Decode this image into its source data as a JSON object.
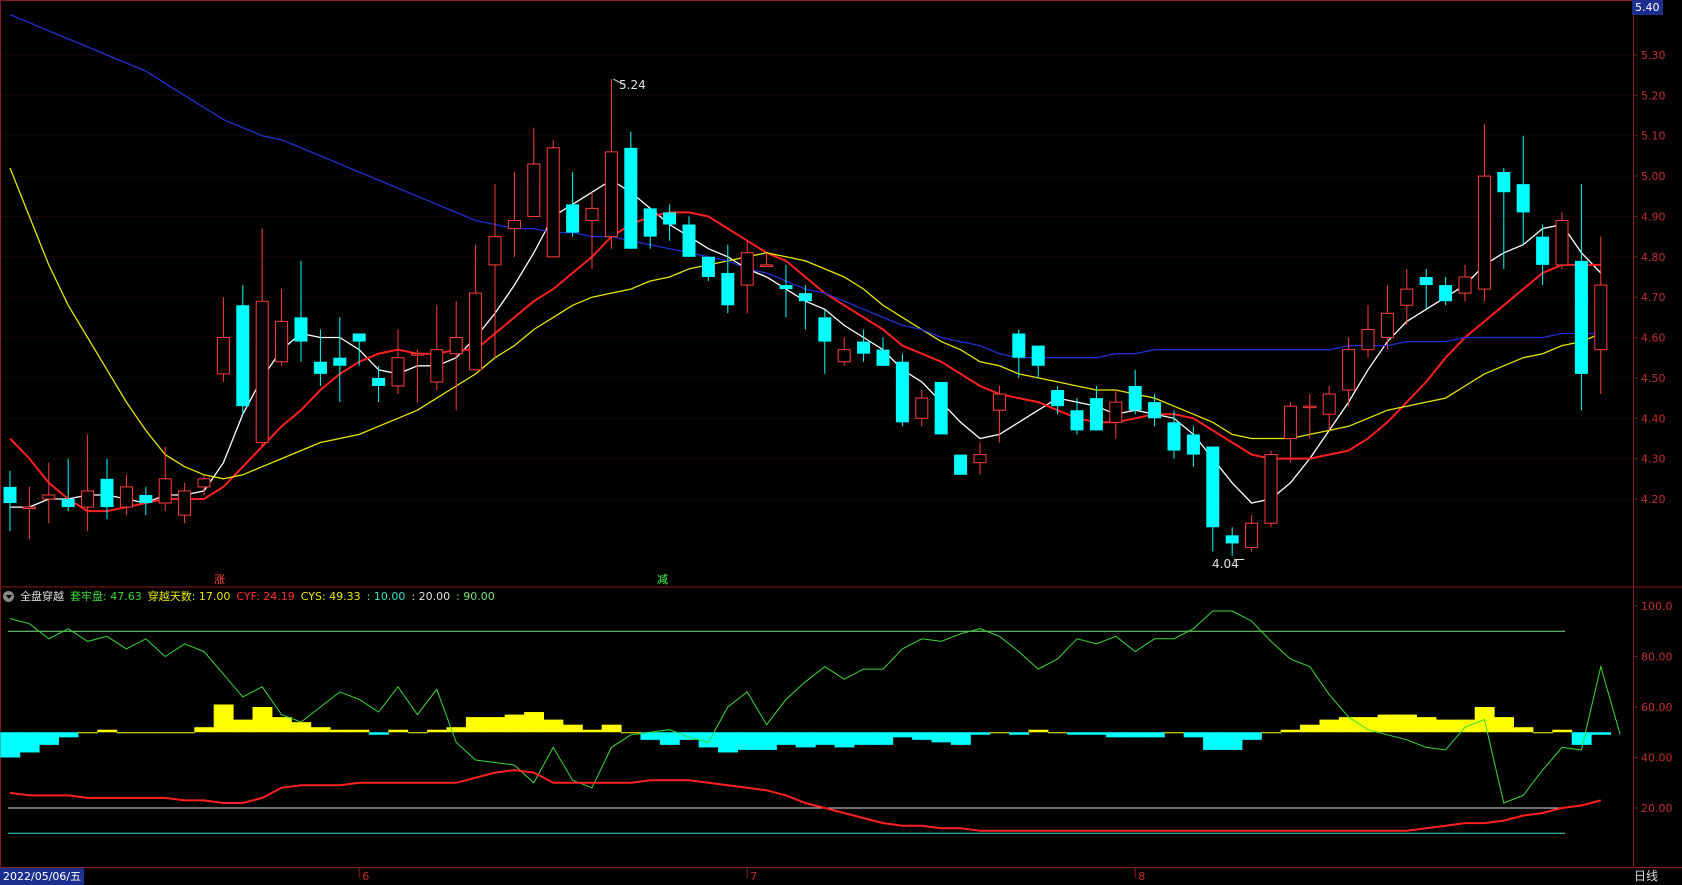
{
  "price_box": "5.40",
  "date_label": "2022/05/06/五",
  "period_label": "日线",
  "indicator": {
    "name": "全盘穿越",
    "items": [
      {
        "label": "套牢盘: 47.63",
        "color": "#39d939"
      },
      {
        "label": "穿越天数: 17.00",
        "color": "#e8e800"
      },
      {
        "label": "CYF: 24.19",
        "color": "#ff3030"
      },
      {
        "label": "CYS: 49.33",
        "color": "#e8e800"
      },
      {
        "label": ": 10.00",
        "color": "#3fe0c0"
      },
      {
        "label": ": 20.00",
        "color": "#e0e0e0"
      },
      {
        "label": ": 90.00",
        "color": "#7fe07f"
      }
    ]
  },
  "markers": {
    "high_label": "5.24",
    "low_label": "4.04",
    "up_tag": "涨",
    "down_tag": "减"
  },
  "chart_data": [
    {
      "type": "candlestick",
      "ylim": [
        4.04,
        5.4
      ],
      "yticks": [
        "5.30",
        "5.20",
        "5.10",
        "5.00",
        "4.90",
        "4.80",
        "4.70",
        "4.60",
        "4.50",
        "4.40",
        "4.30",
        "4.20"
      ],
      "month_labels": [
        {
          "index": 18,
          "label": "6"
        },
        {
          "index": 38,
          "label": "7"
        },
        {
          "index": 58,
          "label": "8"
        }
      ],
      "colors": {
        "up": "#ff3d3d",
        "down": "#00ffff"
      },
      "candles": [
        [
          4.23,
          4.19,
          4.27,
          4.12
        ],
        [
          4.18,
          4.18,
          4.23,
          4.1
        ],
        [
          4.2,
          4.21,
          4.29,
          4.14
        ],
        [
          4.2,
          4.18,
          4.3,
          4.17
        ],
        [
          4.18,
          4.22,
          4.36,
          4.12
        ],
        [
          4.25,
          4.18,
          4.3,
          4.15
        ],
        [
          4.18,
          4.23,
          4.26,
          4.16
        ],
        [
          4.21,
          4.19,
          4.23,
          4.16
        ],
        [
          4.19,
          4.25,
          4.33,
          4.17
        ],
        [
          4.16,
          4.22,
          4.24,
          4.14
        ],
        [
          4.23,
          4.25,
          4.26,
          4.21
        ],
        [
          4.51,
          4.6,
          4.7,
          4.49
        ],
        [
          4.68,
          4.43,
          4.73,
          4.41
        ],
        [
          4.34,
          4.69,
          4.87,
          4.33
        ],
        [
          4.54,
          4.64,
          4.72,
          4.53
        ],
        [
          4.65,
          4.59,
          4.79,
          4.54
        ],
        [
          4.54,
          4.51,
          4.62,
          4.48
        ],
        [
          4.55,
          4.53,
          4.65,
          4.44
        ],
        [
          4.61,
          4.59,
          4.61,
          4.53
        ],
        [
          4.5,
          4.48,
          4.53,
          4.44
        ],
        [
          4.48,
          4.55,
          4.62,
          4.46
        ],
        [
          4.56,
          4.56,
          4.57,
          4.44
        ],
        [
          4.49,
          4.57,
          4.68,
          4.47
        ],
        [
          4.56,
          4.6,
          4.69,
          4.42
        ],
        [
          4.52,
          4.71,
          4.83,
          4.52
        ],
        [
          4.78,
          4.85,
          4.98,
          4.55
        ],
        [
          4.87,
          4.89,
          5.01,
          4.8
        ],
        [
          4.9,
          5.03,
          5.12,
          4.92
        ],
        [
          4.8,
          5.07,
          5.09,
          4.86
        ],
        [
          4.93,
          4.86,
          5.01,
          4.85
        ],
        [
          4.89,
          4.92,
          4.96,
          4.77
        ],
        [
          4.85,
          5.06,
          5.24,
          4.82
        ],
        [
          5.07,
          4.82,
          5.11,
          4.82
        ],
        [
          4.92,
          4.85,
          4.92,
          4.82
        ],
        [
          4.91,
          4.88,
          4.93,
          4.84
        ],
        [
          4.88,
          4.8,
          4.9,
          4.8
        ],
        [
          4.8,
          4.75,
          4.8,
          4.74
        ],
        [
          4.76,
          4.68,
          4.83,
          4.66
        ],
        [
          4.73,
          4.81,
          4.84,
          4.66
        ],
        [
          4.78,
          4.78,
          4.81,
          4.78
        ],
        [
          4.73,
          4.72,
          4.78,
          4.65
        ],
        [
          4.71,
          4.69,
          4.73,
          4.62
        ],
        [
          4.65,
          4.59,
          4.67,
          4.51
        ],
        [
          4.54,
          4.57,
          4.6,
          4.53
        ],
        [
          4.59,
          4.56,
          4.62,
          4.54
        ],
        [
          4.57,
          4.53,
          4.6,
          4.53
        ],
        [
          4.54,
          4.39,
          4.56,
          4.38
        ],
        [
          4.4,
          4.45,
          4.47,
          4.38
        ],
        [
          4.49,
          4.36,
          4.49,
          4.36
        ],
        [
          4.31,
          4.26,
          4.31,
          4.26
        ],
        [
          4.29,
          4.31,
          4.34,
          4.26
        ],
        [
          4.42,
          4.46,
          4.48,
          4.34
        ],
        [
          4.61,
          4.55,
          4.62,
          4.5
        ],
        [
          4.58,
          4.53,
          4.56,
          4.5
        ],
        [
          4.47,
          4.43,
          4.48,
          4.41
        ],
        [
          4.42,
          4.37,
          4.45,
          4.36
        ],
        [
          4.45,
          4.37,
          4.48,
          4.37
        ],
        [
          4.39,
          4.44,
          4.47,
          4.35
        ],
        [
          4.48,
          4.42,
          4.52,
          4.41
        ],
        [
          4.44,
          4.4,
          4.46,
          4.38
        ],
        [
          4.39,
          4.32,
          4.42,
          4.3
        ],
        [
          4.36,
          4.31,
          4.38,
          4.28
        ],
        [
          4.33,
          4.13,
          4.33,
          4.07
        ],
        [
          4.11,
          4.09,
          4.13,
          4.06
        ],
        [
          4.08,
          4.14,
          4.16,
          4.07
        ],
        [
          4.14,
          4.31,
          4.32,
          4.13
        ],
        [
          4.35,
          4.43,
          4.44,
          4.29
        ],
        [
          4.43,
          4.43,
          4.46,
          4.35
        ],
        [
          4.41,
          4.46,
          4.48,
          4.37
        ],
        [
          4.47,
          4.57,
          4.6,
          4.43
        ],
        [
          4.57,
          4.62,
          4.68,
          4.55
        ],
        [
          4.6,
          4.66,
          4.73,
          4.57
        ],
        [
          4.68,
          4.72,
          4.77,
          4.63
        ],
        [
          4.75,
          4.73,
          4.77,
          4.67
        ],
        [
          4.73,
          4.69,
          4.75,
          4.68
        ],
        [
          4.71,
          4.75,
          4.78,
          4.69
        ],
        [
          4.72,
          5.0,
          5.13,
          4.69
        ],
        [
          5.01,
          4.96,
          5.02,
          4.77
        ],
        [
          4.98,
          4.91,
          5.1,
          4.83
        ],
        [
          4.85,
          4.78,
          4.88,
          4.73
        ],
        [
          4.78,
          4.89,
          4.91,
          4.77
        ],
        [
          4.79,
          4.51,
          4.98,
          4.42
        ],
        [
          4.57,
          4.73,
          4.85,
          4.46
        ]
      ],
      "ma": [
        {
          "name": "MA5",
          "color": "#ffffff",
          "values": [
            4.18,
            4.18,
            4.2,
            4.2,
            4.21,
            4.21,
            4.2,
            4.19,
            4.21,
            4.21,
            4.22,
            4.29,
            4.41,
            4.5,
            4.57,
            4.61,
            4.6,
            4.6,
            4.57,
            4.52,
            4.51,
            4.53,
            4.53,
            4.55,
            4.6,
            4.66,
            4.73,
            4.81,
            4.9,
            4.93,
            4.96,
            4.99,
            4.96,
            4.92,
            4.88,
            4.85,
            4.82,
            4.8,
            4.77,
            4.75,
            4.72,
            4.69,
            4.67,
            4.63,
            4.6,
            4.57,
            4.52,
            4.49,
            4.44,
            4.39,
            4.35,
            4.36,
            4.39,
            4.42,
            4.45,
            4.44,
            4.43,
            4.41,
            4.42,
            4.41,
            4.4,
            4.36,
            4.3,
            4.24,
            4.19,
            4.2,
            4.24,
            4.3,
            4.37,
            4.44,
            4.52,
            4.59,
            4.64,
            4.67,
            4.7,
            4.73,
            4.78,
            4.81,
            4.83,
            4.87,
            4.88,
            4.81,
            4.76
          ]
        },
        {
          "name": "MA10",
          "color": "#ff2020",
          "values": [
            4.35,
            4.3,
            4.24,
            4.2,
            4.17,
            4.17,
            4.18,
            4.19,
            4.2,
            4.2,
            4.2,
            4.23,
            4.28,
            4.33,
            4.38,
            4.42,
            4.47,
            4.51,
            4.54,
            4.56,
            4.57,
            4.56,
            4.56,
            4.57,
            4.57,
            4.61,
            4.65,
            4.69,
            4.72,
            4.76,
            4.8,
            4.85,
            4.88,
            4.9,
            4.91,
            4.91,
            4.9,
            4.87,
            4.84,
            4.81,
            4.79,
            4.75,
            4.71,
            4.68,
            4.65,
            4.62,
            4.58,
            4.56,
            4.54,
            4.51,
            4.48,
            4.46,
            4.45,
            4.44,
            4.42,
            4.4,
            4.39,
            4.39,
            4.4,
            4.41,
            4.41,
            4.4,
            4.37,
            4.34,
            4.31,
            4.3,
            4.3,
            4.3,
            4.31,
            4.32,
            4.35,
            4.39,
            4.44,
            4.49,
            4.55,
            4.6,
            4.64,
            4.68,
            4.72,
            4.76,
            4.78,
            4.78,
            4.78
          ]
        },
        {
          "name": "MA20",
          "color": "#e6e600",
          "values": [
            5.02,
            4.9,
            4.78,
            4.68,
            4.6,
            4.52,
            4.44,
            4.37,
            4.31,
            4.28,
            4.26,
            4.25,
            4.26,
            4.28,
            4.3,
            4.32,
            4.34,
            4.35,
            4.36,
            4.38,
            4.4,
            4.42,
            4.45,
            4.48,
            4.51,
            4.55,
            4.58,
            4.62,
            4.65,
            4.68,
            4.7,
            4.71,
            4.72,
            4.74,
            4.75,
            4.77,
            4.78,
            4.79,
            4.8,
            4.81,
            4.8,
            4.79,
            4.77,
            4.75,
            4.72,
            4.68,
            4.65,
            4.62,
            4.59,
            4.57,
            4.54,
            4.53,
            4.51,
            4.5,
            4.49,
            4.48,
            4.47,
            4.47,
            4.46,
            4.45,
            4.43,
            4.41,
            4.39,
            4.36,
            4.35,
            4.35,
            4.35,
            4.36,
            4.37,
            4.38,
            4.4,
            4.42,
            4.43,
            4.44,
            4.45,
            4.48,
            4.51,
            4.53,
            4.55,
            4.56,
            4.58,
            4.59,
            4.61
          ]
        },
        {
          "name": "MA60",
          "color": "#2030d0",
          "values": [
            5.4,
            5.38,
            5.36,
            5.34,
            5.32,
            5.3,
            5.28,
            5.26,
            5.23,
            5.2,
            5.17,
            5.14,
            5.12,
            5.1,
            5.09,
            5.07,
            5.05,
            5.03,
            5.01,
            4.99,
            4.97,
            4.95,
            4.93,
            4.91,
            4.89,
            4.88,
            4.87,
            4.87,
            4.86,
            4.86,
            4.85,
            4.85,
            4.84,
            4.83,
            4.82,
            4.81,
            4.8,
            4.79,
            4.77,
            4.76,
            4.74,
            4.72,
            4.71,
            4.69,
            4.67,
            4.65,
            4.63,
            4.62,
            4.6,
            4.59,
            4.58,
            4.56,
            4.55,
            4.55,
            4.55,
            4.55,
            4.55,
            4.56,
            4.56,
            4.57,
            4.57,
            4.57,
            4.57,
            4.57,
            4.57,
            4.57,
            4.57,
            4.57,
            4.57,
            4.58,
            4.58,
            4.58,
            4.59,
            4.59,
            4.59,
            4.6,
            4.6,
            4.6,
            4.6,
            4.6,
            4.61,
            4.61,
            4.61
          ]
        }
      ]
    },
    {
      "type": "line",
      "ylim": [
        0,
        110
      ],
      "yticks": [
        "100.0",
        "80.00",
        "60.00",
        "40.00",
        "20.00"
      ],
      "hlines": [
        {
          "value": 90,
          "color": "#7fe07f"
        },
        {
          "value": 20,
          "color": "#e0e0e0"
        },
        {
          "value": 10,
          "color": "#3fe0c0"
        }
      ],
      "baseline": 50,
      "histogram_colors": {
        "above": "#ffff00",
        "below": "#00ffff"
      },
      "series": [
        {
          "name": "套牢盘",
          "color": "#39d939",
          "values": [
            95,
            93,
            87,
            91,
            86,
            88,
            83,
            87,
            80,
            85,
            82,
            73,
            64,
            68,
            57,
            54,
            60,
            66,
            63,
            58,
            68,
            57,
            67,
            46,
            39,
            38,
            37,
            30,
            44,
            31,
            28,
            44,
            49,
            50,
            51,
            48,
            46,
            60,
            66,
            53,
            63,
            70,
            76,
            71,
            75,
            75,
            83,
            87,
            86,
            89,
            91,
            88,
            82,
            75,
            79,
            87,
            85,
            88,
            82,
            87,
            87,
            91,
            98,
            98,
            94,
            86,
            79,
            76,
            65,
            56,
            51,
            49,
            47,
            44,
            43,
            52,
            55,
            22,
            25,
            35,
            44,
            43,
            76,
            49
          ]
        },
        {
          "name": "CYF",
          "color": "#ff2020",
          "values": [
            26,
            25,
            25,
            25,
            24,
            24,
            24,
            24,
            24,
            23,
            23,
            22,
            22,
            24,
            28,
            29,
            29,
            29,
            30,
            30,
            30,
            30,
            30,
            30,
            32,
            34,
            35,
            34,
            30,
            30,
            30,
            30,
            30,
            31,
            31,
            31,
            30,
            29,
            28,
            27,
            25,
            22,
            20,
            18,
            16,
            14,
            13,
            13,
            12,
            12,
            11,
            11,
            11,
            11,
            11,
            11,
            11,
            11,
            11,
            11,
            11,
            11,
            11,
            11,
            11,
            11,
            11,
            11,
            11,
            11,
            11,
            11,
            11,
            12,
            13,
            14,
            14,
            15,
            17,
            18,
            20,
            21,
            23
          ]
        },
        {
          "name": "CYS",
          "color": "#e8e800",
          "values": [
            40,
            42,
            45,
            48,
            50,
            51,
            50,
            50,
            50,
            50,
            52,
            61,
            55,
            60,
            56,
            54,
            52,
            51,
            51,
            49,
            51,
            50,
            51,
            52,
            56,
            56,
            57,
            58,
            55,
            53,
            51,
            53,
            50,
            47,
            45,
            47,
            44,
            42,
            43,
            43,
            45,
            44,
            45,
            44,
            45,
            45,
            48,
            47,
            46,
            45,
            49,
            50,
            49,
            51,
            50,
            49,
            49,
            48,
            48,
            48,
            50,
            48,
            43,
            43,
            47,
            50,
            51,
            53,
            55,
            56,
            56,
            57,
            57,
            56,
            55,
            55,
            60,
            56,
            52,
            50,
            51,
            45,
            49
          ]
        }
      ]
    }
  ]
}
